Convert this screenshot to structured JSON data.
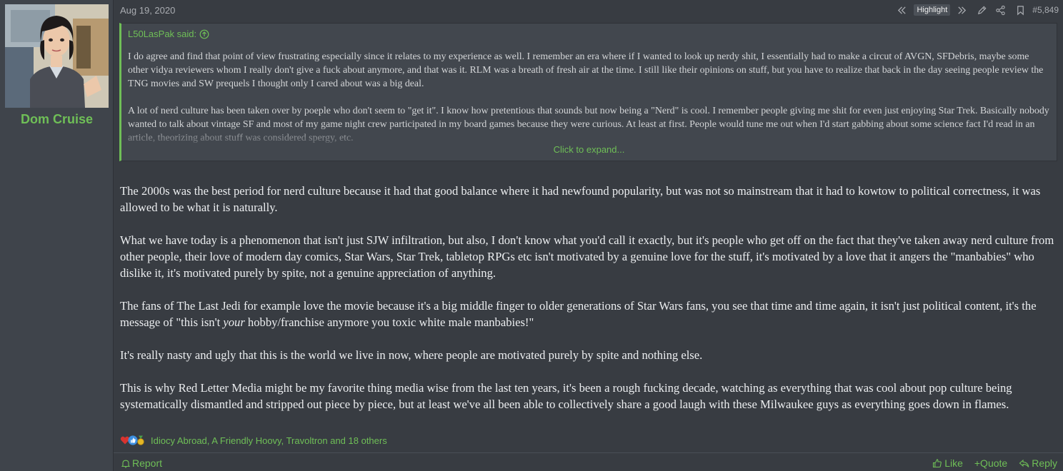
{
  "user": {
    "name": "Dom Cruise",
    "avatar_icon": "user-avatar"
  },
  "post": {
    "date": "Aug 19, 2020",
    "highlight_label": "Highlight",
    "number": "#5,849",
    "quote": {
      "author": "L50LasPak said:",
      "paragraphs": [
        "I do agree and find that point of view frustrating especially since it relates to my experience as well. I remember an era where if I wanted to look up nerdy shit, I essentially had to make a circut of AVGN, SFDebris, maybe some other vidya reviewers whom I really don't give a fuck about anymore, and that was it. RLM was a breath of fresh air at the time. I still like their opinions on stuff, but you have to realize that back in the day seeing people review the TNG movies and SW prequels I thought only I cared about was a big deal.",
        "A lot of nerd culture has been taken over by poeple who don't seem to \"get it\". I know how pretentious that sounds but now being a \"Nerd\" is cool. I remember people giving me shit for even just enjoying Star Trek. Basically nobody wanted to talk about vintage SF and most of my game night crew participated in my board games because they were curious. At least at first. People would tune me out when I'd start gabbing about some science fact I'd read in an article, theorizing about stuff was considered spergy, etc."
      ],
      "expand_label": "Click to expand..."
    },
    "body": {
      "p1": "The 2000s was the best period for nerd culture because it had that good balance where it had newfound popularity, but was not so mainstream that it had to kowtow to political correctness, it was allowed to be what it is naturally.",
      "p2": "What we have today is a phenomenon that isn't just SJW infiltration, but also, I don't know what you'd call it exactly, but it's people who get off on the fact that they've taken away nerd culture from other people, their love of modern day comics, Star Wars, Star Trek, tabletop RPGs etc isn't motivated by a genuine love for the stuff, it's motivated by a love that it angers the \"manbabies\" who dislike it, it's motivated purely by spite, not a genuine appreciation of anything.",
      "p3_before": "The fans of The Last Jedi for example love the movie because it's a big middle finger to older generations of Star Wars fans, you see that time and time again, it isn't just political content, it's the message of \"this isn't ",
      "p3_em": "your",
      "p3_after": " hobby/franchise anymore you toxic white male manbabies!\"",
      "p4": "It's really nasty and ugly that this is the world we live in now, where people are motivated purely by spite and nothing else.",
      "p5": "This is why Red Letter Media might be my favorite thing media wise from the last ten years, it's been a rough fucking decade, watching as everything that was cool about pop culture being systematically dismantled and stripped out piece by piece, but at least we've all been able to collectively share a good laugh with these Milwaukee guys as everything goes down in flames."
    },
    "reactions": {
      "icons": [
        "heart-icon",
        "thumbs-up-icon",
        "medal-icon"
      ],
      "list_text": "Idiocy Abroad, A Friendly Hoovy, Travoltron and 18 others"
    },
    "footer": {
      "report": "Report",
      "like": "Like",
      "quote": "+Quote",
      "reply": "Reply"
    }
  },
  "colors": {
    "accent": "#6fbf57",
    "background": "#383c42",
    "sidebar": "#3f444b",
    "quote_bg": "#42474e"
  }
}
